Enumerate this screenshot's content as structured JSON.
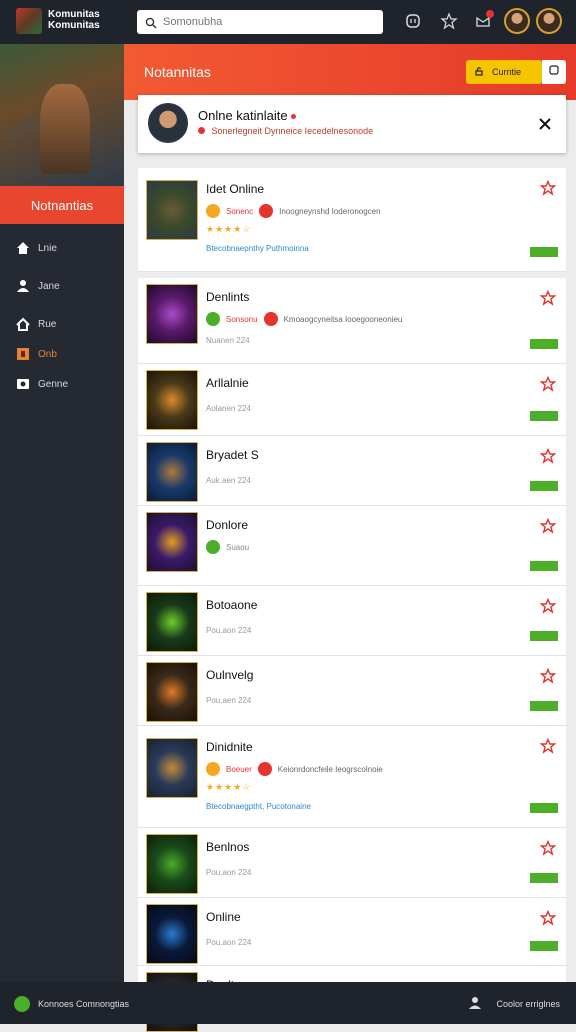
{
  "brand": {
    "line1": "Komunitas",
    "line2": "Komunitas"
  },
  "search": {
    "placeholder": "Somonubha"
  },
  "sidebar": {
    "title": "Notnantias",
    "items": [
      {
        "label": "Lnie",
        "icon": "home-icon"
      },
      {
        "label": "Jane",
        "icon": "users-icon"
      },
      {
        "label": "Rue",
        "icon": "house-icon"
      },
      {
        "label": "Onb",
        "icon": "orange-box-icon"
      },
      {
        "label": "Genne",
        "icon": "camera-icon"
      }
    ]
  },
  "banner": {
    "title": "Notannitas",
    "button_label": "Curntie"
  },
  "notice": {
    "title": "Onlne katinlaite",
    "subtitle": "Sonerlegneit Dynneice Iecedelnesonode"
  },
  "list": [
    {
      "title": "Idet Online",
      "kind": "rich",
      "meta1": "Sonenc",
      "meta2": "Inoogneynshd Ioderonogcen",
      "rating": "★★★★☆",
      "link": "Btecobnaepnthy Puthmoinna",
      "thumb": [
        "#3a4a2a",
        "#6a5a3a",
        "#2a3a4a"
      ]
    },
    {
      "title": "Denlints",
      "kind": "mid",
      "date": "Nuanen 224",
      "meta1": "Sonsonu",
      "meta2": "Kmoaogcyneitsa Iooegooneonieu",
      "thumb": [
        "#5a1a6a",
        "#aa4aca",
        "#1a0a2a"
      ]
    },
    {
      "title": "Arllalnie",
      "kind": "plain",
      "date": "Aolanen 224",
      "thumb": [
        "#4a3a1a",
        "#d98a2a",
        "#1a1208"
      ]
    },
    {
      "title": "Bryadet S",
      "kind": "plain",
      "date": "Auk.aen 224",
      "thumb": [
        "#1a3a6a",
        "#aa7a3a",
        "#0a1a3a"
      ]
    },
    {
      "title": "Donlore",
      "kind": "small",
      "date": "",
      "meta1": "Suaou",
      "thumb": [
        "#3a1a6a",
        "#e0a020",
        "#1a1030"
      ]
    },
    {
      "title": "Botoaone",
      "kind": "plain",
      "date": "Pou.aon 224",
      "thumb": [
        "#1a3a1a",
        "#6ad02a",
        "#0a1a0a"
      ]
    },
    {
      "title": "Oulnvelg",
      "kind": "plain",
      "date": "Pou.aen 224",
      "thumb": [
        "#3a2a1a",
        "#e07a2a",
        "#1a1008"
      ]
    },
    {
      "title": "Dinidnite",
      "kind": "rich",
      "meta1": "Boeuer",
      "meta2": "Keionrdoncfeile Ieogrscolnoie",
      "rating": "★★★★☆",
      "link": "Btecobnaegptht, Pucotonaine",
      "thumb": [
        "#2a3a5a",
        "#c08a3a",
        "#1a2030"
      ]
    },
    {
      "title": "Benlnos",
      "kind": "plain",
      "date": "Pou.aon 224",
      "thumb": [
        "#1a4a1a",
        "#4aaa2a",
        "#0a200a"
      ]
    },
    {
      "title": "Online",
      "kind": "plain",
      "date": "Pou.aon 224",
      "thumb": [
        "#0a1a3a",
        "#2a7ad0",
        "#050a1a"
      ]
    },
    {
      "title": "Donlte",
      "kind": "partial",
      "date": "",
      "thumb": [
        "#2a2a2a",
        "#6a6a6a",
        "#101010"
      ]
    }
  ],
  "bottom": {
    "left_label": "Konnoes Comnongtias",
    "right_label": "Coolor erriglnes"
  },
  "colors": {
    "accent": "#e8462f",
    "dark": "#1f232c",
    "yellow": "#f7c400",
    "green": "#4caf2a"
  }
}
